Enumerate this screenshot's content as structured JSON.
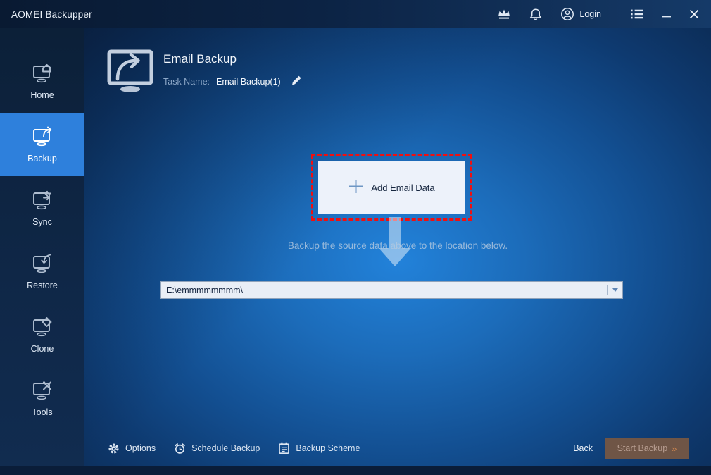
{
  "colors": {
    "accent_blue": "#2e80dc",
    "annotation_red": "#f10f0f",
    "start_button_bg": "#6f5546",
    "titlebar_bg": "#0c2344",
    "field_bg": "#e9eef6"
  },
  "titlebar": {
    "app_title": "AOMEI Backupper",
    "login_label": "Login"
  },
  "sidebar": {
    "items": [
      {
        "label": "Home",
        "active": false
      },
      {
        "label": "Backup",
        "active": true
      },
      {
        "label": "Sync",
        "active": false
      },
      {
        "label": "Restore",
        "active": false
      },
      {
        "label": "Clone",
        "active": false
      },
      {
        "label": "Tools",
        "active": false
      }
    ]
  },
  "header": {
    "title": "Email Backup",
    "task_name_label": "Task Name:",
    "task_name_value": "Email Backup(1)"
  },
  "main": {
    "add_button_label": "Add Email Data",
    "flow_hint": "Backup the source data above to the location below.",
    "destination_path": "E:\\emmmmmmmm\\"
  },
  "footer": {
    "options_label": "Options",
    "schedule_label": "Schedule Backup",
    "scheme_label": "Backup Scheme",
    "back_label": "Back",
    "start_label": "Start Backup",
    "start_chevrons": "»"
  }
}
